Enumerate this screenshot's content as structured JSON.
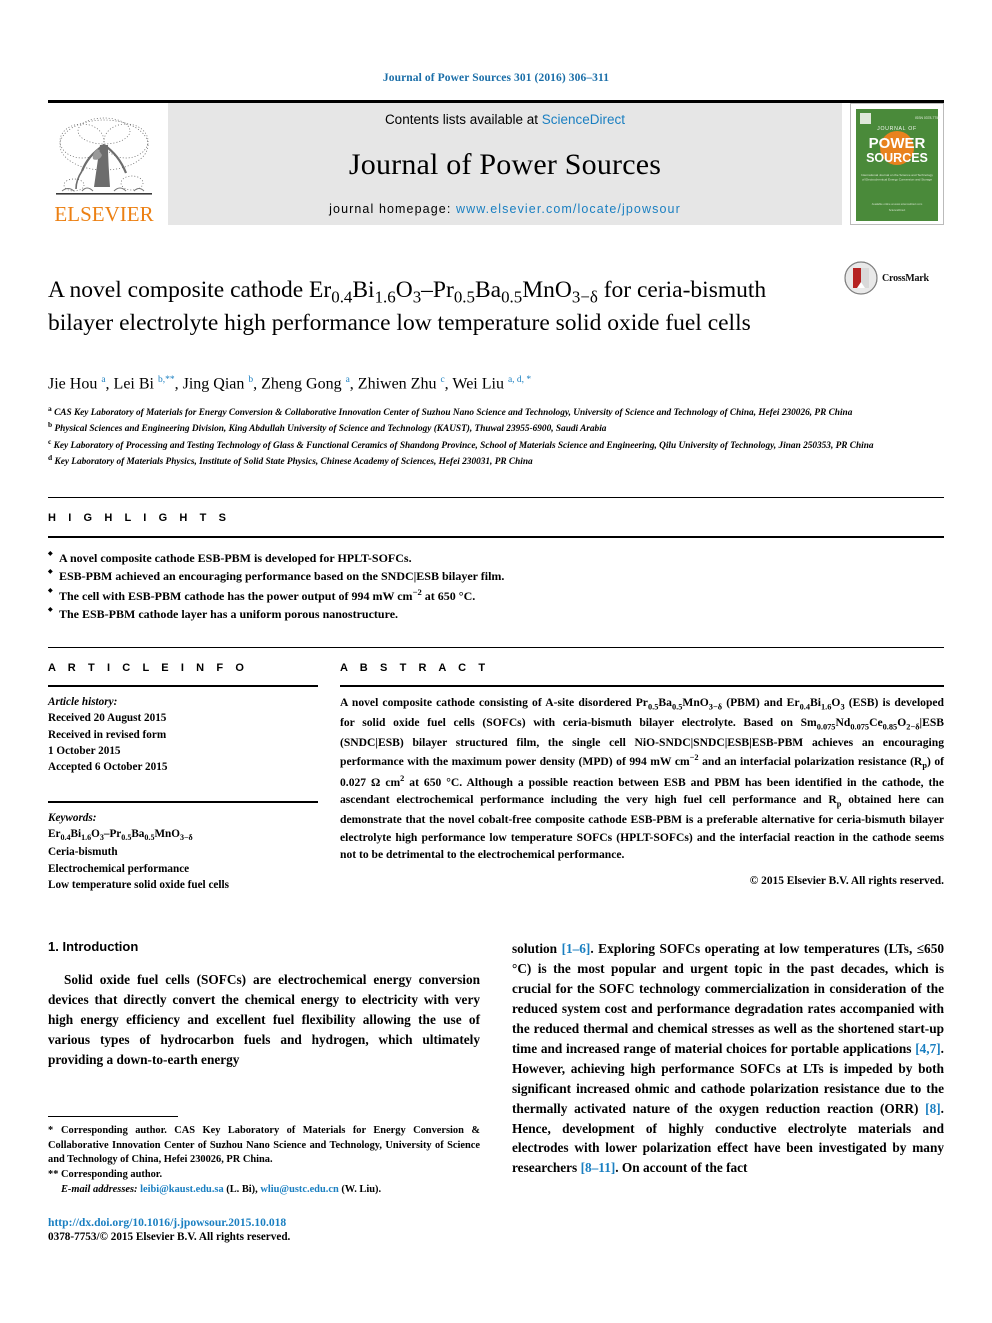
{
  "running_head": "Journal of Power Sources 301 (2016) 306–311",
  "masthead": {
    "publisher_logo_text": "ELSEVIER",
    "contents_prefix": "Contents lists available at ",
    "contents_link": "ScienceDirect",
    "journal_title": "Journal of Power Sources",
    "homepage_prefix": "journal homepage: ",
    "homepage_url": "www.elsevier.com/locate/jpowsour",
    "cover": {
      "top_label": "JOURNAL OF",
      "word1": "POWER",
      "word2": "SOURCES",
      "blurb": "International Journal on the Science and Technology of Electro­chemical Energy Conversion and Storage including Batteries and Fuel Cells",
      "footer": "Available online at www.sciencedirect.com ScienceDirect"
    },
    "accent_blue": "#1a7fc1",
    "elsevier_orange": "#ec8013",
    "cover_green": "#4a8a3a"
  },
  "article": {
    "title_line1_a": "A novel composite cathode Er",
    "title": "A novel composite cathode Er0.4Bi1.6O3–Pr0.5Ba0.5MnO3−δ for ceria-bismuth bilayer electrolyte high performance low temperature solid oxide fuel cells",
    "crossmark_label": "CrossMark",
    "authors_plain": "Jie Hou a, Lei Bi b,**, Jing Qian b, Zheng Gong a, Zhiwen Zhu c, Wei Liu a,d,*",
    "affiliations": [
      "CAS Key Laboratory of Materials for Energy Conversion & Collaborative Innovation Center of Suzhou Nano Science and Technology, University of Science and Technology of China, Hefei 230026, PR China",
      "Physical Sciences and Engineering Division, King Abdullah University of Science and Technology (KAUST), Thuwal 23955-6900, Saudi Arabia",
      "Key Laboratory of Processing and Testing Technology of Glass & Functional Ceramics of Shandong Province, School of Materials Science and Engineering, Qilu University of Technology, Jinan 250353, PR China",
      "Key Laboratory of Materials Physics, Institute of Solid State Physics, Chinese Academy of Sciences, Hefei 230031, PR China"
    ]
  },
  "highlights": {
    "heading": "H I G H L I G H T S",
    "items": [
      "A novel composite cathode ESB-PBM is developed for HPLT-SOFCs.",
      "ESB-PBM achieved an encouraging performance based on the SNDC|ESB bilayer film.",
      "The cell with ESB-PBM cathode has the power output of 994 mW cm−2 at 650 °C.",
      "The ESB-PBM cathode layer has a uniform porous nanostructure."
    ]
  },
  "article_info": {
    "heading": "A R T I C L E    I N F O",
    "history_label": "Article history:",
    "history": [
      "Received 20 August 2015",
      "Received in revised form",
      "1 October 2015",
      "Accepted 6 October 2015"
    ],
    "keywords_label": "Keywords:",
    "keywords": [
      "Er0.4Bi1.6O3–Pr0.5Ba0.5MnO3−δ",
      "Ceria-bismuth",
      "Electrochemical performance",
      "Low temperature solid oxide fuel cells"
    ]
  },
  "abstract": {
    "heading": "A B S T R A C T",
    "text": "A novel composite cathode consisting of A-site disordered Pr0.5Ba0.5MnO3−δ (PBM) and Er0.4Bi1.6O3 (ESB) is developed for solid oxide fuel cells (SOFCs) with ceria-bismuth bilayer electrolyte. Based on Sm0.075Nd0.075Ce0.85O2−δ|ESB (SNDC|ESB) bilayer structured film, the single cell NiO-SNDC|SNDC|ESB|ESB-PBM achieves an encouraging performance with the maximum power density (MPD) of 994 mW cm−2 and an interfacial polarization resistance (Rp) of 0.027 Ω cm2 at 650 °C. Although a possible reaction between ESB and PBM has been identified in the cathode, the ascendant electrochemical performance including the very high fuel cell performance and Rp obtained here can demonstrate that the novel cobalt-free composite cathode ESB-PBM is a preferable alternative for ceria-bismuth bilayer electrolyte high performance low temperature SOFCs (HPLT-SOFCs) and the interfacial reaction in the cathode seems not to be detrimental to the electrochemical performance.",
    "copyright": "© 2015 Elsevier B.V. All rights reserved."
  },
  "body": {
    "section_number_title": "1. Introduction",
    "left_paragraph": "Solid oxide fuel cells (SOFCs) are electrochemical energy conversion devices that directly convert the chemical energy to electricity with very high energy efficiency and excellent fuel flexibility allowing the use of various types of hydrocarbon fuels and hydrogen, which ultimately providing a down-to-earth energy",
    "right_paragraph_part1": "solution ",
    "right_ref1": "[1–6]",
    "right_paragraph_part2": ". Exploring SOFCs operating at low temperatures (LTs, ≤650 °C) is the most popular and urgent topic in the past decades, which is crucial for the SOFC technology commercialization in consideration of the reduced system cost and performance degradation rates accompanied with the reduced thermal and chemical stresses as well as the shortened start-up time and increased range of material choices for portable applications ",
    "right_ref2": "[4,7]",
    "right_paragraph_part3": ". However, achieving high performance SOFCs at LTs is impeded by both significant increased ohmic and cathode polarization resistance due to the thermally activated nature of the oxygen reduction reaction (ORR) ",
    "right_ref3": "[8]",
    "right_paragraph_part4": ". Hence, development of highly conductive electrolyte materials and electrodes with lower polarization effect have been investigated by many researchers ",
    "right_ref4": "[8–11]",
    "right_paragraph_part5": ". On account of the fact"
  },
  "footnotes": {
    "corr1_mark": "*",
    "corr1": "Corresponding author. CAS Key Laboratory of Materials for Energy Conversion & Collaborative Innovation Center of Suzhou Nano Science and Technology, University of Science and Technology of China, Hefei 230026, PR China.",
    "corr2_mark": "**",
    "corr2": "Corresponding author.",
    "email_label": "E-mail addresses:",
    "email1": "leibi@kaust.edu.sa",
    "email1_who": "(L. Bi),",
    "email2": "wliu@ustc.edu.cn",
    "email2_who": "(W. Liu).",
    "doi": "http://dx.doi.org/10.1016/j.jpowsour.2015.10.018",
    "issn_line": "0378-7753/© 2015 Elsevier B.V. All rights reserved."
  }
}
